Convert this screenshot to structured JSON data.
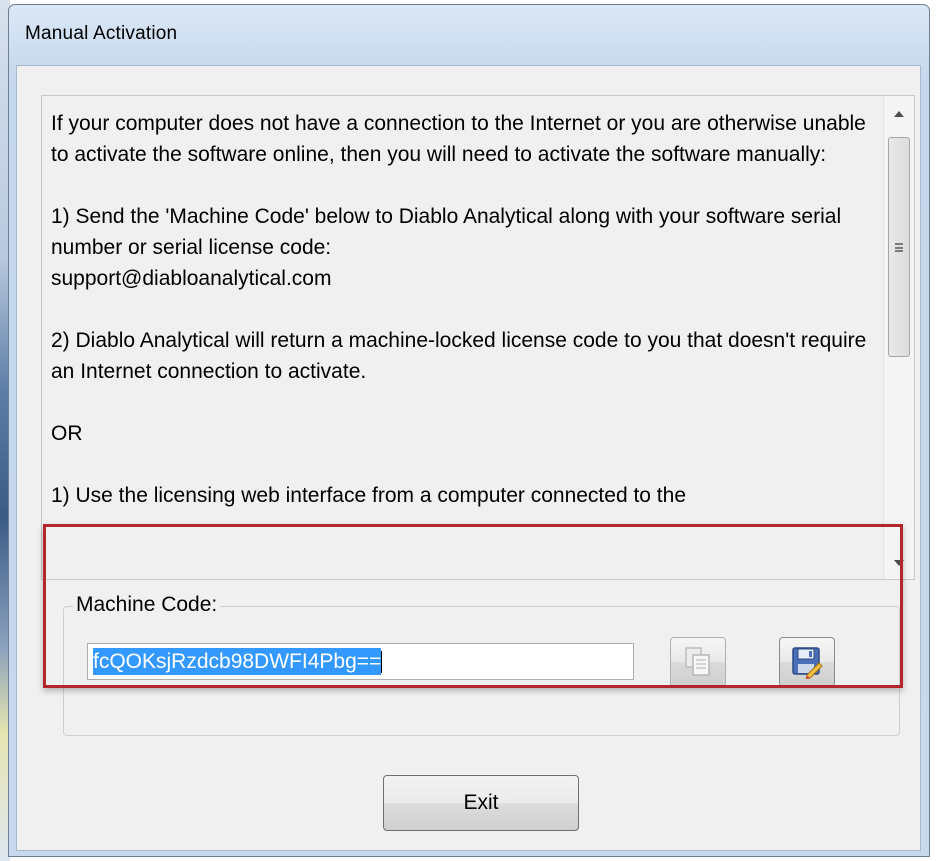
{
  "window": {
    "title": "Manual Activation"
  },
  "info": {
    "text": "If your computer does not have a connection to the Internet or you are otherwise unable to activate the software online, then you will need to activate the software manually:\n\n1) Send the 'Machine Code' below to Diablo Analytical along with your software serial number or serial license code:\nsupport@diabloanalytical.com\n\n2) Diablo Analytical will return a machine-locked license code to you that doesn't require an Internet connection to activate.\n\nOR\n\n1) Use the licensing web interface from a computer connected to the"
  },
  "machine_code": {
    "group_label": "Machine Code:",
    "value": "fcQOKsjRzdcb98DWFI4Pbg=="
  },
  "buttons": {
    "copy_icon": "copy-icon",
    "save_icon": "save-icon",
    "exit_label": "Exit"
  },
  "colors": {
    "highlight_frame": "#b3262a",
    "selection": "#3399ff"
  }
}
